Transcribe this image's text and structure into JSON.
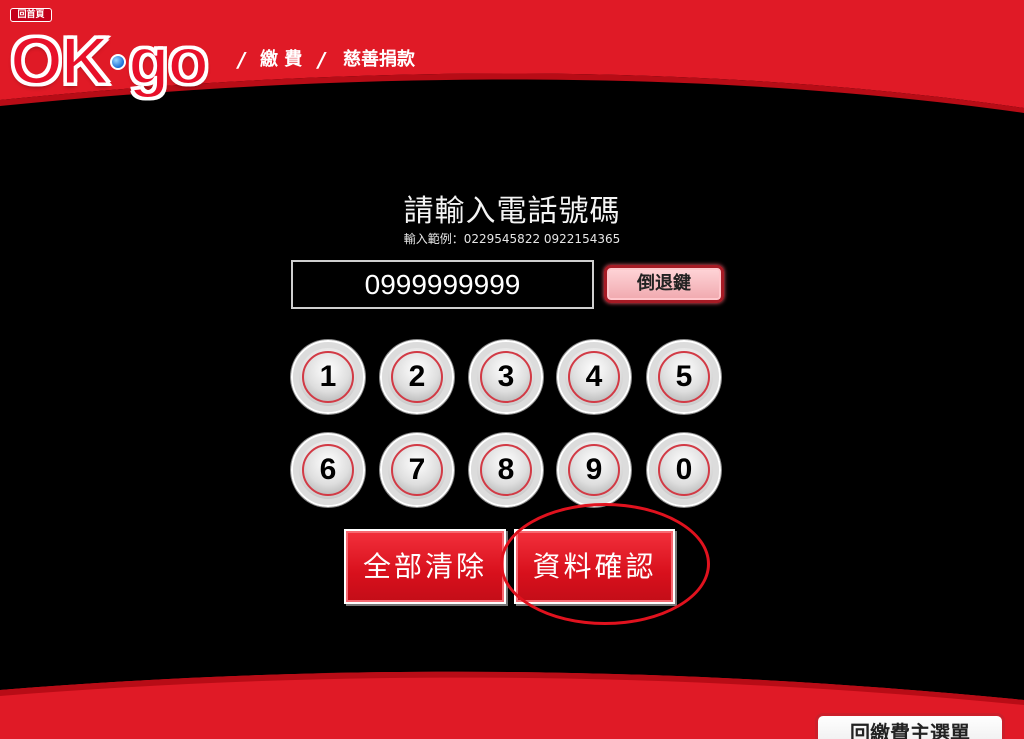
{
  "header": {
    "home_tag": "回首頁",
    "logo_left": "OK",
    "logo_right": "go",
    "crumb_sep": "/",
    "breadcrumb": [
      "繳 費",
      "慈善捐款"
    ]
  },
  "prompt": {
    "title": "請輸入電話號碼",
    "example": "輸入範例：0229545822 0922154365"
  },
  "input": {
    "value": "0999999999"
  },
  "backspace_label": "倒退鍵",
  "keypad": [
    "1",
    "2",
    "3",
    "4",
    "5",
    "6",
    "7",
    "8",
    "9",
    "0"
  ],
  "actions": {
    "clear_label": "全部清除",
    "confirm_label": "資料確認"
  },
  "footer": {
    "back_menu_label": "回繳費主選單"
  },
  "colors": {
    "brand_red": "#e8102a",
    "background": "#000000"
  }
}
